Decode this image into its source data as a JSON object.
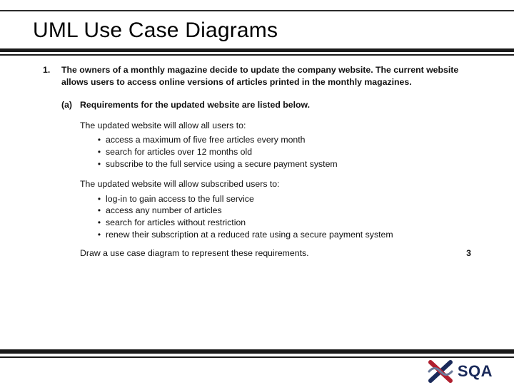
{
  "title": "UML Use Case Diagrams",
  "question": {
    "number": "1.",
    "text": "The owners of a monthly magazine decide to update the company website. The current website allows users to access online versions of articles printed in the monthly magazines.",
    "part": {
      "label": "(a)",
      "text": "Requirements for the updated website are listed below.",
      "group1": {
        "intro": "The updated website will allow all users to:",
        "items": [
          "access a maximum of five free articles every month",
          "search for articles over 12 months old",
          "subscribe to the full service using a secure payment system"
        ]
      },
      "group2": {
        "intro": "The updated website will allow subscribed users to:",
        "items": [
          "log-in to gain access to the full service",
          "access any number of articles",
          "search for articles without restriction",
          "renew their subscription at a reduced rate using a secure payment system"
        ]
      },
      "instruction": "Draw a use case diagram to represent these requirements.",
      "marks": "3"
    }
  },
  "logo": {
    "text": "SQA"
  }
}
